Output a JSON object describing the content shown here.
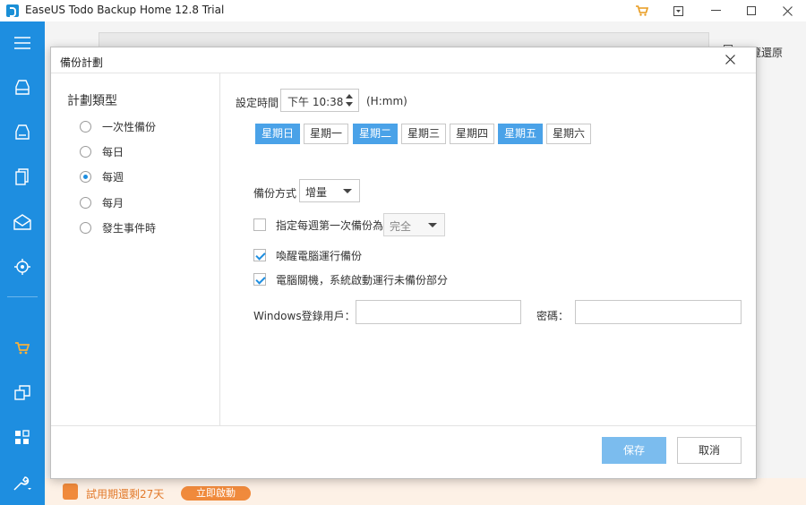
{
  "app": {
    "title": "EaseUS Todo Backup Home 12.8 Trial",
    "cart_icon": "cart-icon",
    "accent_color": "#1e8ee0"
  },
  "window_controls": {
    "menu": "▣",
    "minimize": "—",
    "maximize": "☐",
    "close": "✕"
  },
  "sidebar": {
    "icons": [
      "menu-icon",
      "disk-backup-icon",
      "system-backup-icon",
      "file-backup-icon",
      "mail-backup-icon",
      "target-icon",
      "cart-icon",
      "clone-icon",
      "tools-grid-icon",
      "wrench-icon"
    ]
  },
  "background": {
    "restore_label": "覽還原",
    "trial_text": "試用期還剩27天",
    "activate_label": "立即啟動"
  },
  "dialog": {
    "title": "備份計劃",
    "close": "✕",
    "plan_type_title": "計劃類型",
    "plan_types": [
      {
        "label": "一次性備份",
        "selected": false
      },
      {
        "label": "每日",
        "selected": false
      },
      {
        "label": "每週",
        "selected": true
      },
      {
        "label": "每月",
        "selected": false
      },
      {
        "label": "發生事件時",
        "selected": false
      }
    ],
    "time_label": "設定時間",
    "time_value": "下午 10:38",
    "time_unit": "(H:mm)",
    "days": [
      {
        "label": "星期日",
        "selected": true
      },
      {
        "label": "星期一",
        "selected": false
      },
      {
        "label": "星期二",
        "selected": true
      },
      {
        "label": "星期三",
        "selected": false
      },
      {
        "label": "星期四",
        "selected": false
      },
      {
        "label": "星期五",
        "selected": true
      },
      {
        "label": "星期六",
        "selected": false
      }
    ],
    "method_label": "備份方式",
    "method_value": "增量",
    "first_backup_label": "指定每週第一次備份為",
    "first_backup_value": "完全",
    "first_backup_checked": false,
    "wake_label": "喚醒電腦運行備份",
    "wake_checked": true,
    "shutdown_label": "電腦關機，系統啟動運行未備份部分",
    "shutdown_checked": true,
    "user_label": "Windows登錄用戶：",
    "user_value": "",
    "password_label": "密碼：",
    "password_value": "",
    "save_label": "保存",
    "cancel_label": "取消"
  }
}
